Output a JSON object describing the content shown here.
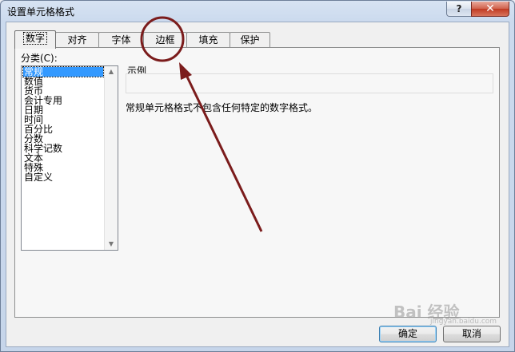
{
  "window": {
    "title": "设置单元格格式"
  },
  "titlebar": {
    "help_label": "?",
    "close_label": "✕"
  },
  "tabs": [
    {
      "label": "数字",
      "active": true
    },
    {
      "label": "对齐",
      "active": false
    },
    {
      "label": "字体",
      "active": false
    },
    {
      "label": "边框",
      "active": false
    },
    {
      "label": "填充",
      "active": false
    },
    {
      "label": "保护",
      "active": false
    }
  ],
  "category": {
    "label": "分类(C):",
    "items": [
      "常规",
      "数值",
      "货币",
      "会计专用",
      "日期",
      "时间",
      "百分比",
      "分数",
      "科学记数",
      "文本",
      "特殊",
      "自定义"
    ],
    "selected_index": 0
  },
  "sample": {
    "label": "示例",
    "value": ""
  },
  "description": "常规单元格格式不包含任何特定的数字格式。",
  "buttons": {
    "ok": "确定",
    "cancel": "取消"
  },
  "annotation": {
    "color": "#7b1c1c",
    "target": "边框"
  },
  "watermark": {
    "text": "Bai 经验",
    "sub": "jingyan.baidu.com"
  }
}
